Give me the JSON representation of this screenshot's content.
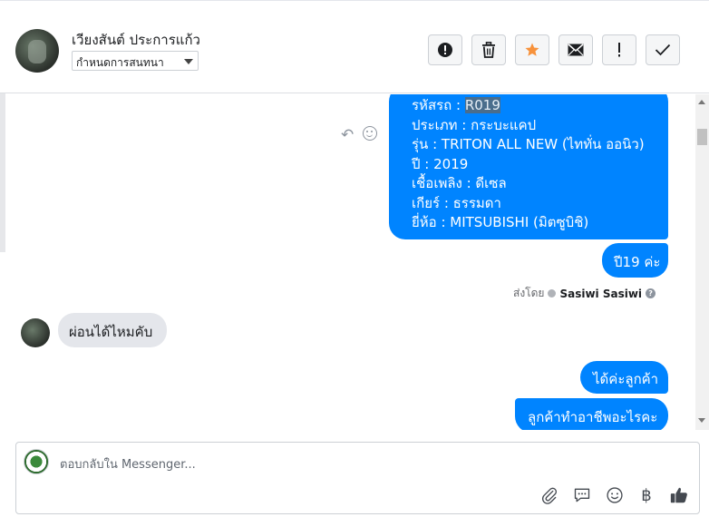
{
  "header": {
    "contact_name": "เวียงสันต์ ประการแก้ว",
    "assign_label": "กำหนดการสนทนา",
    "toolbar_icons": [
      "alert-circle-icon",
      "trash-icon",
      "star-icon",
      "envelope-icon",
      "exclamation-icon",
      "check-icon"
    ],
    "star_color": "#f7923b"
  },
  "conversation": {
    "car_details": {
      "code_label": "รหัสรถ : ",
      "code_value": "R019",
      "type": "ประเภท : กระบะแคป",
      "model": "รุ่น : TRITON ALL NEW (ไททั่น ออนิว)",
      "year": "ปี : 2019",
      "fuel": "เชื้อเพลิง : ดีเซล",
      "gear": "เกียร์ : ธรรมดา",
      "brand": "ยี่ห้อ : MITSUBISHI (มิตซูบิชิ)"
    },
    "reply_year": "ปี19 ค่ะ",
    "sent_by_label": "ส่งโดย",
    "sent_by_name": "Sasiwi Sasiwi",
    "incoming_message": "ผ่อนได้ไหมคับ",
    "reply_ok": "ได้ค่ะลูกค้า",
    "reply_job": "ลูกค้าทำอาชีพอะไรคะ",
    "outgoing_color": "#0084ff",
    "incoming_color": "#e4e6eb"
  },
  "composer": {
    "placeholder": "ตอบกลับใน Messenger...",
    "icons": [
      "paperclip-icon",
      "saved-reply-icon",
      "emoji-icon",
      "baht-icon",
      "thumbs-up-icon"
    ],
    "currency_glyph": "฿"
  }
}
